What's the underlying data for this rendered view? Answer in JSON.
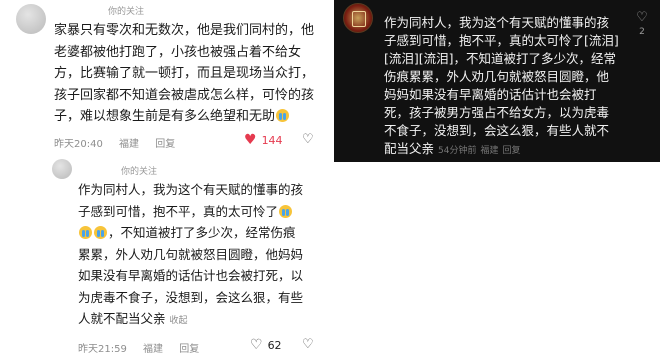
{
  "comments": [
    {
      "text_lines": [
        "家暴只有零次和无数次，他是我们同村的，他",
        "老婆都被他打跑了，小孩也被强占着不给女",
        "方，比赛输了就一顿打，而且是现场当众打，",
        "孩子回家都不知道会被虐成怎么样，可怜的孩",
        "子，难以想象生前是有多么绝望和无助"
      ],
      "emoji": "crying-face",
      "time": "昨天20:40",
      "location": "福建",
      "reply_label": "回复",
      "like_count": "144",
      "liked": true
    },
    {
      "tag": "你的关注",
      "text_lines": [
        "作为同村人，我为这个有天赋的懂事的孩",
        "子感到可惜，抱不平，真的太可怜了",
        "，不知道被打了多少次，经常伤痕",
        "累累，外人劝几句就被怒目圆瞪，他妈妈",
        "如果没有早离婚的话估计也会被打死，以",
        "为虎毒不食子，没想到，会这么狠，有些",
        "人就不配当父亲"
      ],
      "collapse_label": "收起",
      "time": "昨天21:59",
      "location": "福建",
      "reply_label": "回复",
      "like_count": "62",
      "liked": false
    },
    {
      "text_lines": [
        "作为同村人，我为这个有天赋的懂事的孩",
        "子感到可惜，抱不平，真的太可怜了[流泪]",
        "[流泪][流泪]，不知道被打了多少次，经常",
        "伤痕累累，外人劝几句就被怒目圆瞪，他",
        "妈妈如果没有早离婚的话估计也会被打",
        "死，孩子被男方强占不给女方，以为虎毒",
        "不食子，没想到，会这么狠，有些人就不",
        "配当父亲"
      ],
      "time": "54分钟前",
      "location": "福建",
      "reply_label": "回复",
      "like_count": "2"
    }
  ],
  "top_tag": "你的关注"
}
